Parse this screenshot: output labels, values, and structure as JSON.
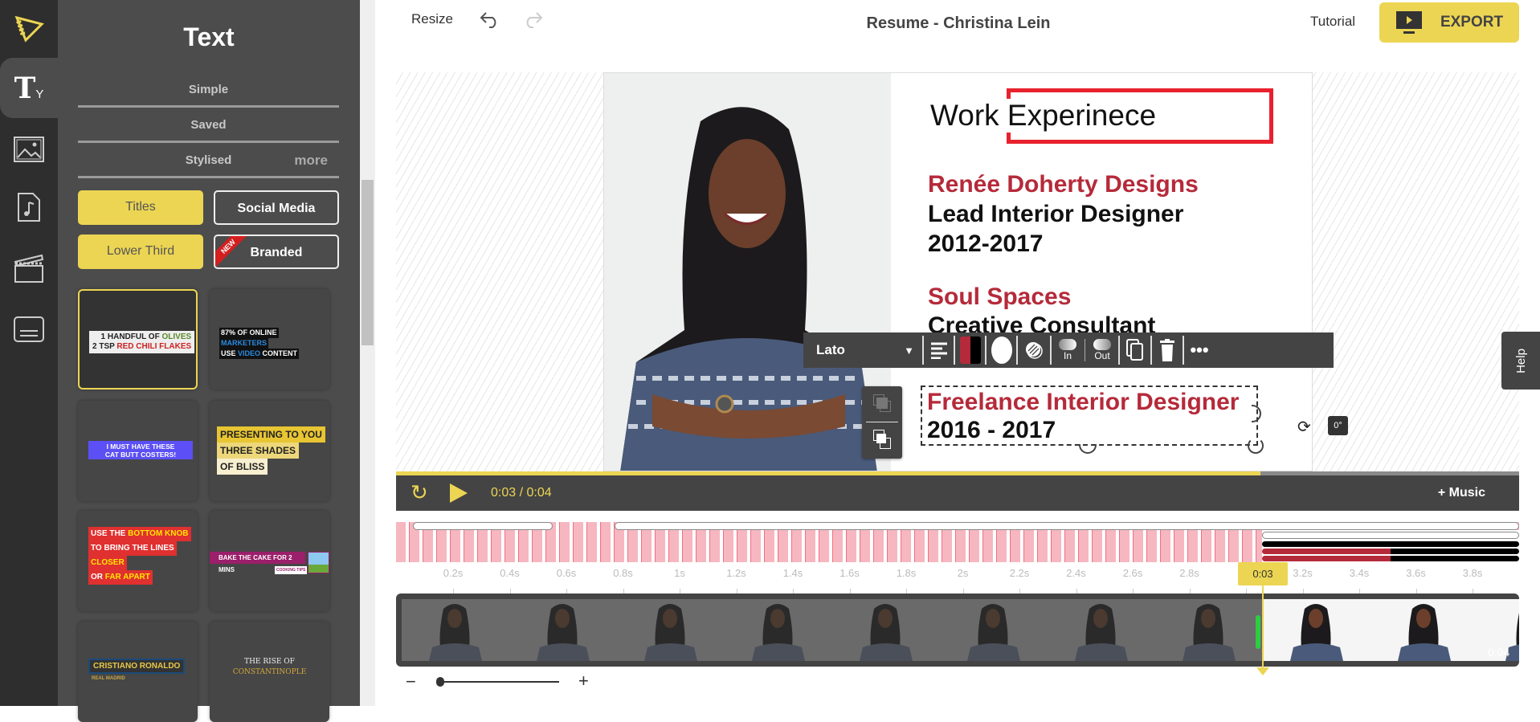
{
  "rail": {
    "items": [
      {
        "icon": "logo-icon"
      },
      {
        "icon": "text-icon",
        "active": true
      },
      {
        "icon": "image-icon"
      },
      {
        "icon": "music-file-icon"
      },
      {
        "icon": "clapperboard-icon"
      },
      {
        "icon": "subtitle-icon"
      }
    ]
  },
  "panel": {
    "title": "Text",
    "tabs": [
      {
        "label": "Simple"
      },
      {
        "label": "Saved"
      },
      {
        "label": "Stylised"
      }
    ],
    "more": "more",
    "buttons": [
      {
        "label": "Titles",
        "active": true
      },
      {
        "label": "Social Media",
        "active": false
      },
      {
        "label": "Lower Third",
        "active": true
      },
      {
        "label": "Branded",
        "active": false,
        "badge": "NEW"
      }
    ],
    "cards": [
      {
        "lines": [
          "1 HANDFUL OF ",
          "OLIVES",
          "2 TSP ",
          "RED CHILI FLAKES"
        ]
      },
      {
        "lines": [
          "87% OF ONLINE",
          "MARKETERS",
          "USE ",
          "VIDEO",
          " CONTENT"
        ]
      },
      {
        "lines": [
          "I MUST HAVE THESE",
          "CAT BUTT COSTERS!"
        ]
      },
      {
        "lines": [
          "PRESENTING TO YOU",
          "THREE SHADES",
          "OF BLISS"
        ]
      },
      {
        "lines": [
          "USE THE ",
          "BOTTOM KNOB",
          "TO BRING THE LINES",
          "CLOSER",
          "OR ",
          "FAR APART"
        ]
      },
      {
        "lines": [
          "BAKE THE CAKE FOR 2 MINS",
          "COOKING TIPS"
        ]
      },
      {
        "lines": [
          "CRISTIANO RONALDO",
          "REAL MADRID"
        ]
      },
      {
        "lines": [
          "THE RISE OF",
          "CONSTANTINOPLE"
        ]
      }
    ]
  },
  "topbar": {
    "resize": "Resize",
    "title": "Resume - Christina Lein",
    "tutorial": "Tutorial",
    "export": "EXPORT"
  },
  "resume": {
    "heading": "Work Experinece",
    "job1": {
      "company": "Renée Doherty Designs",
      "role": "Lead Interior Designer",
      "years": "2012-2017"
    },
    "job2": {
      "company": "Soul Spaces",
      "role": "Creative Consultant"
    },
    "job3": {
      "role": "Freelance Interior Designer",
      "years": "2016 - 2017"
    },
    "accent": "#b52a3a"
  },
  "toolbar": {
    "font": "Lato",
    "in": "In",
    "out": "Out",
    "rotation": "0°"
  },
  "player": {
    "current": "0:03",
    "separator": "/",
    "total": "0:04",
    "music": "+ Music",
    "progress": 0.77
  },
  "timeline": {
    "ticks": [
      "0.2s",
      "0.4s",
      "0.6s",
      "0.8s",
      "1s",
      "1.2s",
      "1.4s",
      "1.6s",
      "1.8s",
      "2s",
      "2.2s",
      "2.4s",
      "2.6s",
      "2.8s",
      "3s",
      "3.2s",
      "3.4s",
      "3.6s",
      "3.8s"
    ],
    "playhead": "0:03",
    "end": "0:04"
  },
  "help": "Help",
  "colors": {
    "accent": "#ecd553",
    "dark": "#444444",
    "red": "#b52a3a"
  }
}
